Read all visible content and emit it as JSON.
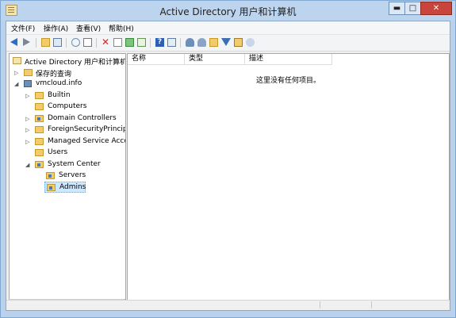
{
  "window": {
    "title": "Active Directory 用户和计算机",
    "minimize_glyph": "▬",
    "maximize_glyph": "□",
    "close_glyph": "✕"
  },
  "menu": {
    "items": [
      "文件(F)",
      "操作(A)",
      "查看(V)",
      "帮助(H)"
    ]
  },
  "toolbar": {
    "icons": [
      "back-icon",
      "forward-icon",
      "up-folder-icon",
      "show-hide-tree-icon",
      "cut-icon",
      "copy-icon",
      "delete-icon",
      "properties-icon",
      "refresh-icon",
      "export-list-icon",
      "help-icon",
      "console-tree-icon",
      "new-user-icon",
      "new-group-icon",
      "new-ou-icon",
      "filter-icon",
      "find-icon",
      "add-to-group-icon"
    ]
  },
  "tree": {
    "root": "Active Directory 用户和计算机",
    "saved_queries": "保存的查询",
    "domain": "vmcloud.info",
    "children": [
      "Builtin",
      "Computers",
      "Domain Controllers",
      "ForeignSecurityPrincipa",
      "Managed Service Acco",
      "Users",
      "System Center"
    ],
    "system_center_children": [
      "Servers",
      "Admins"
    ],
    "selected": "Admins"
  },
  "list": {
    "columns": [
      "名称",
      "类型",
      "描述"
    ],
    "empty_message": "这里没有任何项目。"
  },
  "colors": {
    "title_bar": "#bcd4ee",
    "close_button": "#c9443a",
    "selection": "#cde8ff"
  }
}
